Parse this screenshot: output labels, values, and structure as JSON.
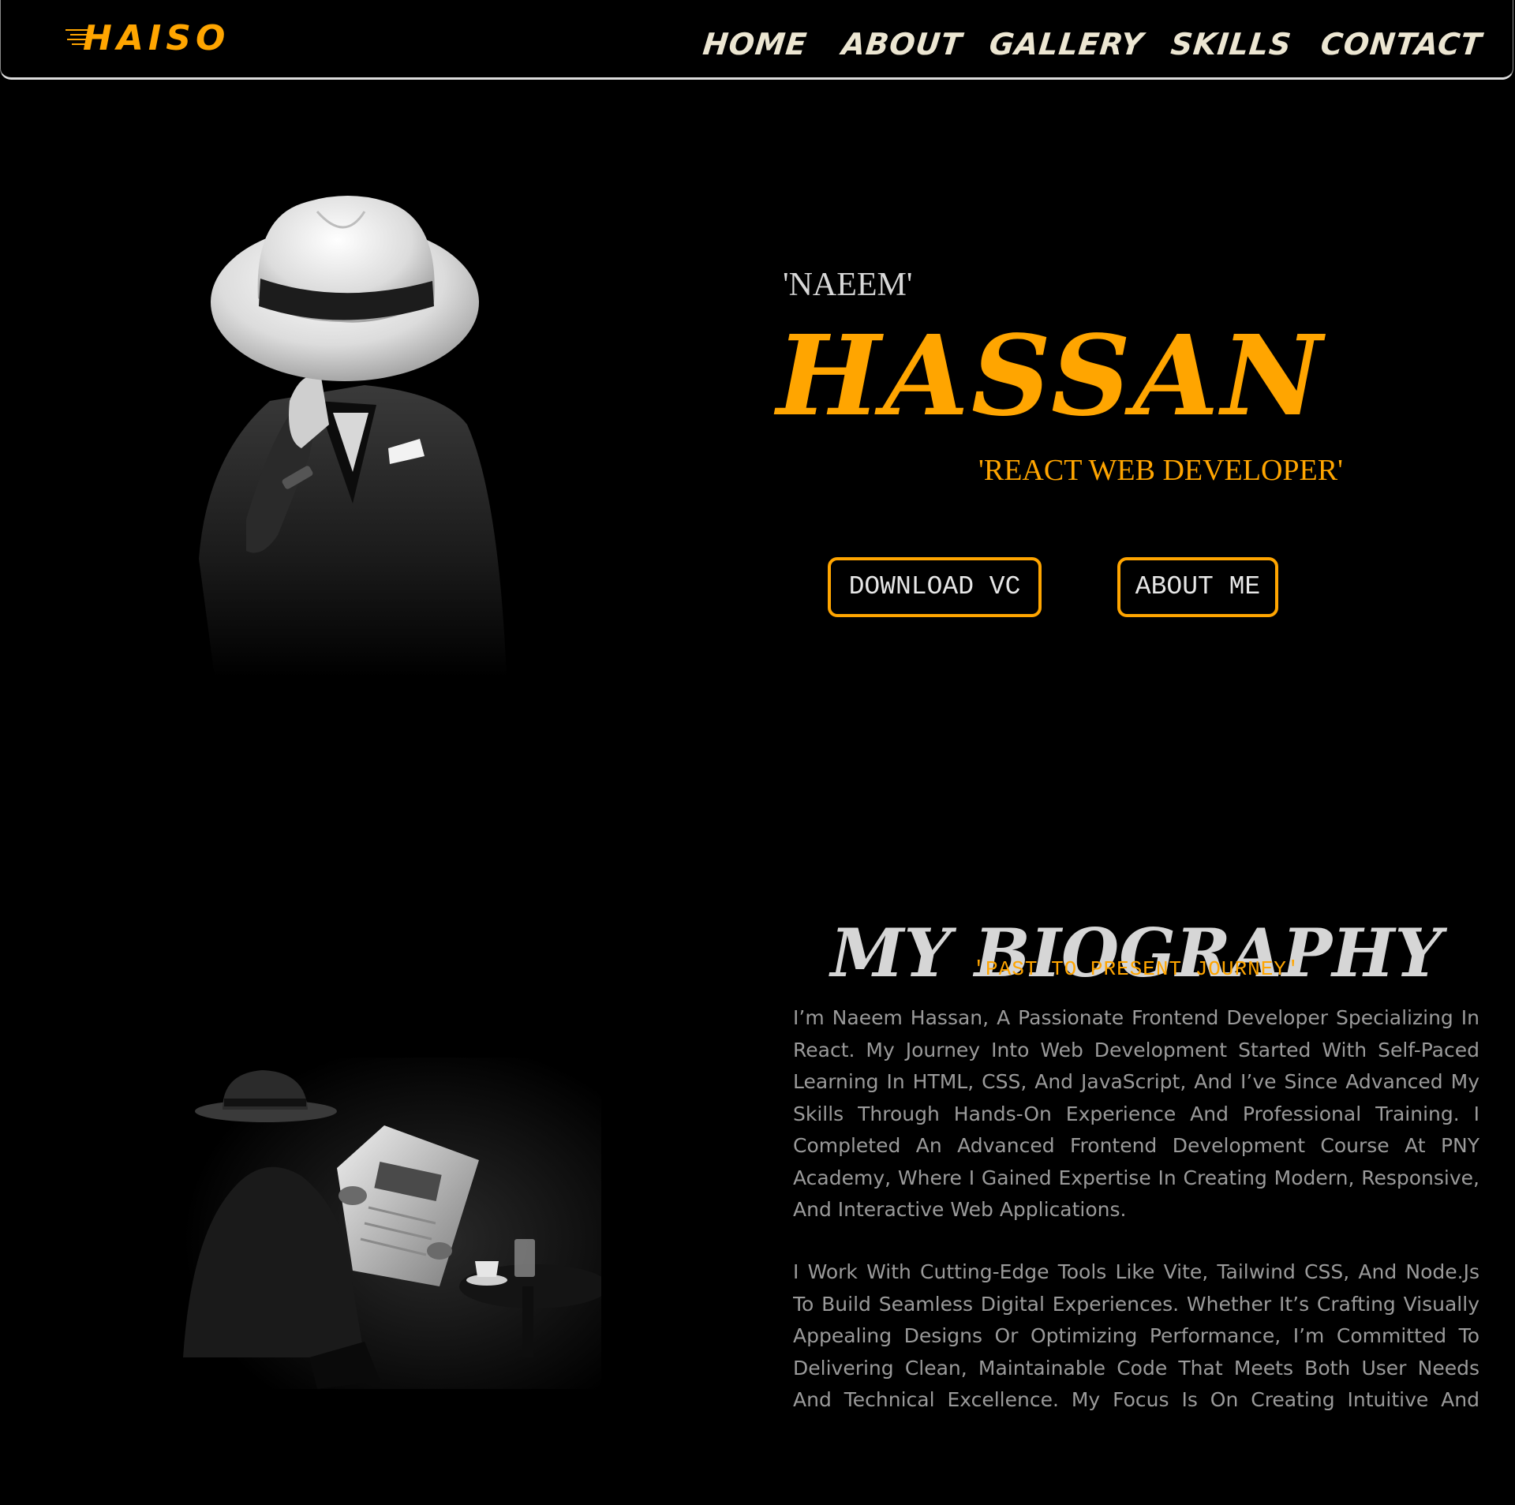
{
  "nav": {
    "logo": "HAISO",
    "links": [
      "HOME",
      "ABOUT",
      "GALLERY",
      "SKILLS",
      "CONTACT"
    ]
  },
  "hero": {
    "first_name": "'NAEEM'",
    "last_name": "HASSAN",
    "role": "'REACT WEB DEVELOPER'",
    "download_button": "DOWNLOAD VC",
    "about_button": "ABOUT ME",
    "photo": "man-in-white-hat-icon"
  },
  "biography": {
    "heading": "MY BIOGRAPHY",
    "tagline": "'PAST TO PRESENT JOURNEY'",
    "paragraph_1": "I’m Naeem Hassan, A Passionate Frontend Developer Specializing In React. My Journey Into Web Development Started With Self-Paced Learning In HTML, CSS, And JavaScript, And I’ve Since Advanced My Skills Through Hands-On Experience And Professional Training. I Completed An Advanced Frontend Development Course At PNY Academy, Where I Gained Expertise In Creating Modern, Responsive, And Interactive Web Applications.",
    "paragraph_2": "I Work With Cutting-Edge Tools Like Vite, Tailwind CSS, And Node.Js To Build Seamless Digital Experiences. Whether It’s Crafting Visually Appealing Designs Or Optimizing Performance, I’m Committed To Delivering Clean, Maintainable Code That Meets Both User Needs And Technical Excellence. My Focus Is On Creating Intuitive And Scalable",
    "photo": "man-reading-newspaper-icon"
  },
  "colors": {
    "accent": "#ffa500",
    "background": "#000000",
    "text_light": "#e6e6e6",
    "text_muted": "#9a9a9a"
  }
}
